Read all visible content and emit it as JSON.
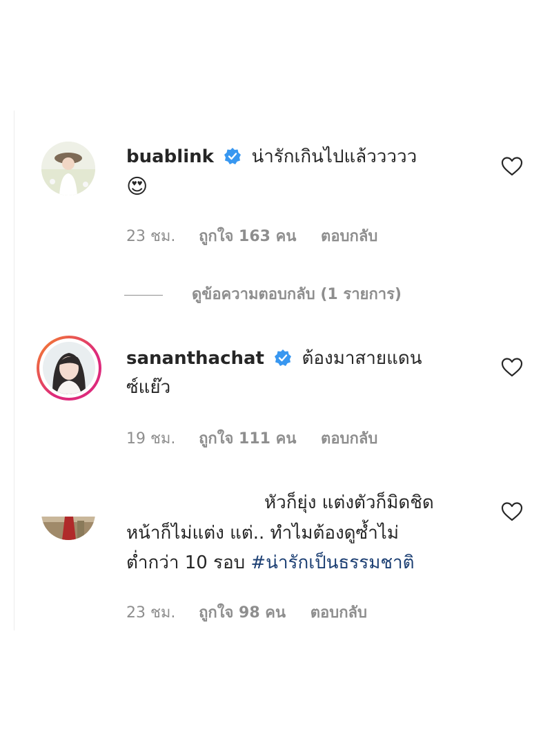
{
  "comments": [
    {
      "username": "buablink",
      "verified": true,
      "text_line1": "น่ารักเกินไปแล้ววววว",
      "emoji": "😍",
      "time": "23 ชม.",
      "likes": "ถูกใจ 163 คน",
      "reply": "ตอบกลับ"
    },
    {
      "username": "sananthachat",
      "verified": true,
      "text_line1": "ต้องมาสายแดน",
      "text_line2": "ซ์แย๊ว",
      "time": "19 ชม.",
      "likes": "ถูกใจ 111 คน",
      "reply": "ตอบกลับ"
    },
    {
      "text_line1": "หัวก็ยุ่ง แต่งตัวก็มิดชิด",
      "text_line2": "หน้าก็ไม่แต่ง แต่.. ทำไมต้องดูซ้ำไม่",
      "text_line3_plain": "ต่ำกว่า 10 รอบ",
      "hashtag": "#น่ารักเป็นธรรมชาติ",
      "time": "23 ชม.",
      "likes": "ถูกใจ 98 คน",
      "reply": "ตอบกลับ"
    }
  ],
  "view_replies": "ดูข้อความตอบกลับ (1 รายการ)",
  "icons": {
    "verified": "verified-badge-icon",
    "heart": "heart-outline-icon"
  },
  "colors": {
    "verified_blue": "#3897f0",
    "meta_gray": "#8e8e8e",
    "hashtag_blue": "#1c3f73",
    "story_ring_start": "#f58529",
    "story_ring_end": "#dd2a7b"
  }
}
